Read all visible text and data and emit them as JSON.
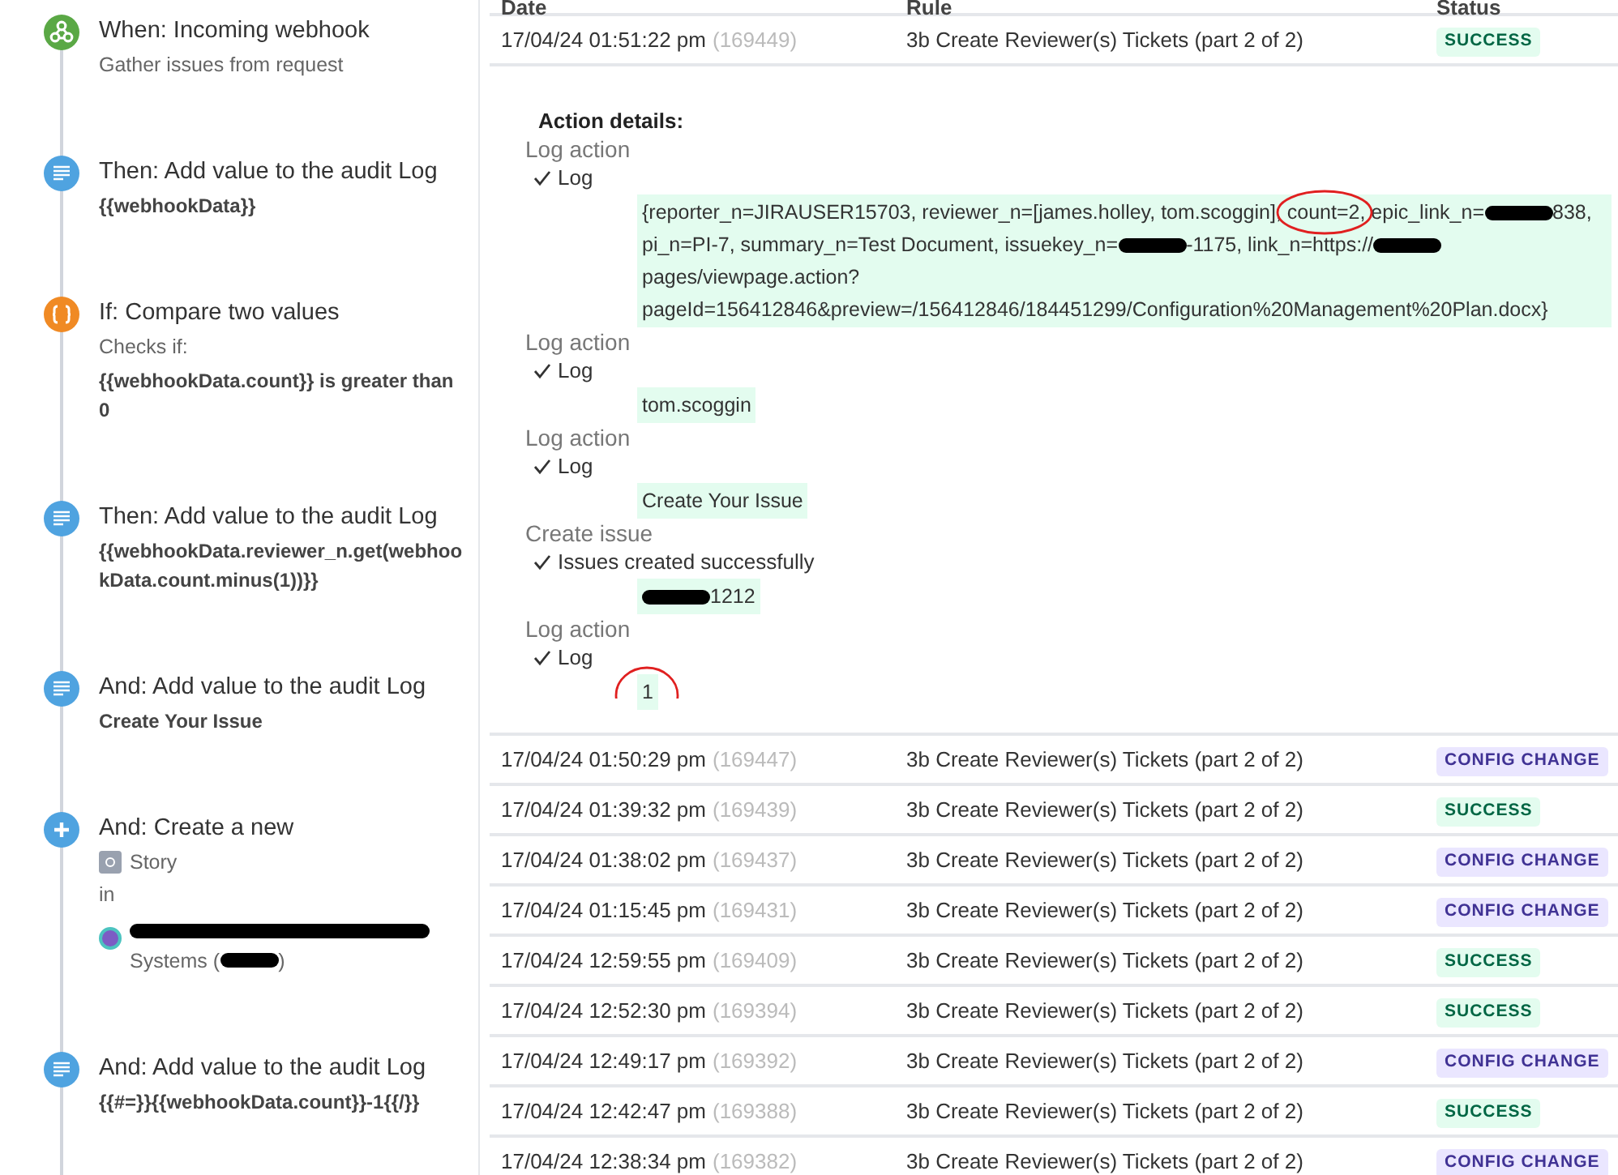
{
  "steps": [
    {
      "kind": "trigger",
      "title": "When: Incoming webhook",
      "lines": [
        {
          "text": "Gather issues from request",
          "bold": false
        }
      ]
    },
    {
      "kind": "log",
      "title": "Then: Add value to the audit Log",
      "lines": [
        {
          "text": "{{webhookData}}",
          "bold": true
        }
      ]
    },
    {
      "kind": "condition",
      "title": "If: Compare two values",
      "lines": [
        {
          "text": "Checks if:",
          "bold": false
        },
        {
          "text": "{{webhookData.count}} is greater than 0",
          "bold": true
        }
      ]
    },
    {
      "kind": "log",
      "title": "Then: Add value to the audit Log",
      "lines": [
        {
          "text": "{{webhookData.reviewer_n.get(webhookData.count.minus(1))}}",
          "bold": true
        }
      ]
    },
    {
      "kind": "log",
      "title": "And: Add value to the audit Log",
      "lines": [
        {
          "text": "Create Your Issue",
          "bold": true
        }
      ]
    },
    {
      "kind": "create",
      "title": "And: Create a new",
      "issue_type": "Story",
      "in_label": "in",
      "project_parts": [
        {
          "kind": "redacted"
        },
        {
          "kind": "text",
          "text": "Systems ("
        },
        {
          "kind": "redacted"
        },
        {
          "kind": "text",
          "text": ")"
        }
      ]
    },
    {
      "kind": "log",
      "title": "And: Add value to the audit Log",
      "lines": [
        {
          "text": "{{#=}}{{webhookData.count}}-1{{/}}",
          "bold": true
        }
      ]
    }
  ],
  "table": {
    "columns": [
      "Date",
      "Rule",
      "Status"
    ],
    "rows": [
      {
        "date": "17/04/24 01:51:22 pm",
        "id": "(169449)",
        "rule": "3b Create Reviewer(s) Tickets (part 2 of 2)",
        "status": {
          "label": "SUCCESS",
          "kind": "success"
        },
        "expanded": true,
        "details": {
          "heading": "Action details:",
          "actions": [
            {
              "title": "Log action",
              "result": "Log",
              "value": [
                {
                  "kind": "text",
                  "text": "{reporter_n=JIRAUSER15703, reviewer_n=[james.holley, tom.scoggin], count=2, epic_link_n="
                },
                {
                  "kind": "redacted"
                },
                {
                  "kind": "text",
                  "text": "838, pi_n=PI-7, summary_n=Test Document, issuekey_n="
                },
                {
                  "kind": "redacted"
                },
                {
                  "kind": "text",
                  "text": "-1175, link_n=https://"
                },
                {
                  "kind": "redacted"
                },
                {
                  "kind": "text",
                  "text": "pages/viewpage.action? pageId=156412846&preview=/156412846/184451299/Configuration%20Management%20Plan.docx}"
                }
              ]
            },
            {
              "title": "Log action",
              "result": "Log",
              "value": [
                {
                  "kind": "text",
                  "text": "tom.scoggin"
                }
              ]
            },
            {
              "title": "Log action",
              "result": "Log",
              "value": [
                {
                  "kind": "text",
                  "text": "Create Your Issue"
                }
              ]
            },
            {
              "title": "Create issue",
              "result": "Issues created successfully",
              "value": [
                {
                  "kind": "redacted"
                },
                {
                  "kind": "text",
                  "text": "1212"
                }
              ]
            },
            {
              "title": "Log action",
              "result": "Log",
              "value": [
                {
                  "kind": "text",
                  "text": "1"
                }
              ]
            }
          ]
        }
      },
      {
        "date": "17/04/24 01:50:29 pm",
        "id": "(169447)",
        "rule": "3b Create Reviewer(s) Tickets (part 2 of 2)",
        "status": {
          "label": "CONFIG CHANGE",
          "kind": "config"
        },
        "expanded": false
      },
      {
        "date": "17/04/24 01:39:32 pm",
        "id": "(169439)",
        "rule": "3b Create Reviewer(s) Tickets (part 2 of 2)",
        "status": {
          "label": "SUCCESS",
          "kind": "success"
        },
        "expanded": false
      },
      {
        "date": "17/04/24 01:38:02 pm",
        "id": "(169437)",
        "rule": "3b Create Reviewer(s) Tickets (part 2 of 2)",
        "status": {
          "label": "CONFIG CHANGE",
          "kind": "config"
        },
        "expanded": false
      },
      {
        "date": "17/04/24 01:15:45 pm",
        "id": "(169431)",
        "rule": "3b Create Reviewer(s) Tickets (part 2 of 2)",
        "status": {
          "label": "CONFIG CHANGE",
          "kind": "config"
        },
        "expanded": false
      },
      {
        "date": "17/04/24 12:59:55 pm",
        "id": "(169409)",
        "rule": "3b Create Reviewer(s) Tickets (part 2 of 2)",
        "status": {
          "label": "SUCCESS",
          "kind": "success"
        },
        "expanded": false
      },
      {
        "date": "17/04/24 12:52:30 pm",
        "id": "(169394)",
        "rule": "3b Create Reviewer(s) Tickets (part 2 of 2)",
        "status": {
          "label": "SUCCESS",
          "kind": "success"
        },
        "expanded": false
      },
      {
        "date": "17/04/24 12:49:17 pm",
        "id": "(169392)",
        "rule": "3b Create Reviewer(s) Tickets (part 2 of 2)",
        "status": {
          "label": "CONFIG CHANGE",
          "kind": "config"
        },
        "expanded": false
      },
      {
        "date": "17/04/24 12:42:47 pm",
        "id": "(169388)",
        "rule": "3b Create Reviewer(s) Tickets (part 2 of 2)",
        "status": {
          "label": "SUCCESS",
          "kind": "success"
        },
        "expanded": false
      },
      {
        "date": "17/04/24 12:38:34 pm",
        "id": "(169382)",
        "rule": "3b Create Reviewer(s) Tickets (part 2 of 2)",
        "status": {
          "label": "CONFIG CHANGE",
          "kind": "config"
        },
        "expanded": false
      }
    ]
  }
}
